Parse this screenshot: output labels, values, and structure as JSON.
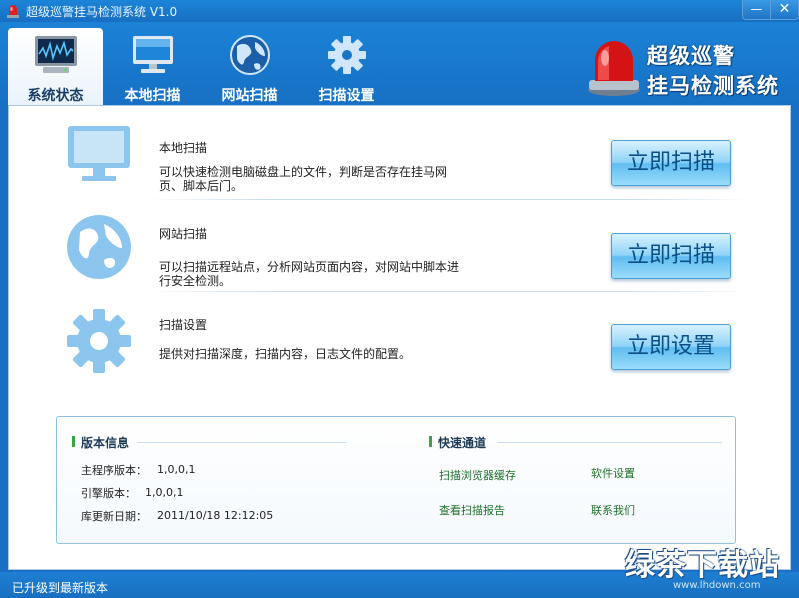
{
  "window": {
    "title": "超级巡警挂马检测系统 V1.0",
    "minimize_glyph": "—",
    "close_glyph": "✕"
  },
  "tabs": [
    {
      "label": "系统状态",
      "icon": "monitor-chart-icon",
      "active": true
    },
    {
      "label": "本地扫描",
      "icon": "computer-icon",
      "active": false
    },
    {
      "label": "网站扫描",
      "icon": "globe-icon",
      "active": false
    },
    {
      "label": "扫描设置",
      "icon": "gear-icon",
      "active": false
    }
  ],
  "brand": {
    "line1": "超级巡警",
    "line2": "挂马检测系统",
    "icon": "siren-icon"
  },
  "features": [
    {
      "title": "本地扫描",
      "desc_line1": "可以快速检测电脑磁盘上的文件，判断是否存在挂马网",
      "desc_line2": "页、脚本后门。",
      "button": "立即扫描",
      "icon": "monitor-icon"
    },
    {
      "title": "网站扫描",
      "desc_line1": "可以扫描远程站点，分析网站页面内容，对网站中脚本进",
      "desc_line2": "行安全检测。",
      "button": "立即扫描",
      "icon": "globe-icon"
    },
    {
      "title": "扫描设置",
      "desc_line1": "提供对扫描深度，扫描内容，日志文件的配置。",
      "button": "立即设置",
      "icon": "gear-icon"
    }
  ],
  "version_info": {
    "title": "版本信息",
    "main_label": "主程序版本：",
    "main_value": "1,0,0,1",
    "engine_label": "引擎版本：",
    "engine_value": "1,0,0,1",
    "db_label": "库更新日期：",
    "db_value": "2011/10/18 12:12:05"
  },
  "quick_links": {
    "title": "快速通道",
    "items": [
      "扫描浏览器缓存",
      "软件设置",
      "查看扫描报告",
      "联系我们"
    ]
  },
  "status": "已升级到最新版本",
  "watermark": {
    "main": "绿茶下载站",
    "url": "www.lhdown.com"
  },
  "colors": {
    "titlebar": "#1c85d8",
    "accent_green": "#3aa341",
    "button_text": "#0a4f86",
    "link": "#1f6f2a"
  }
}
